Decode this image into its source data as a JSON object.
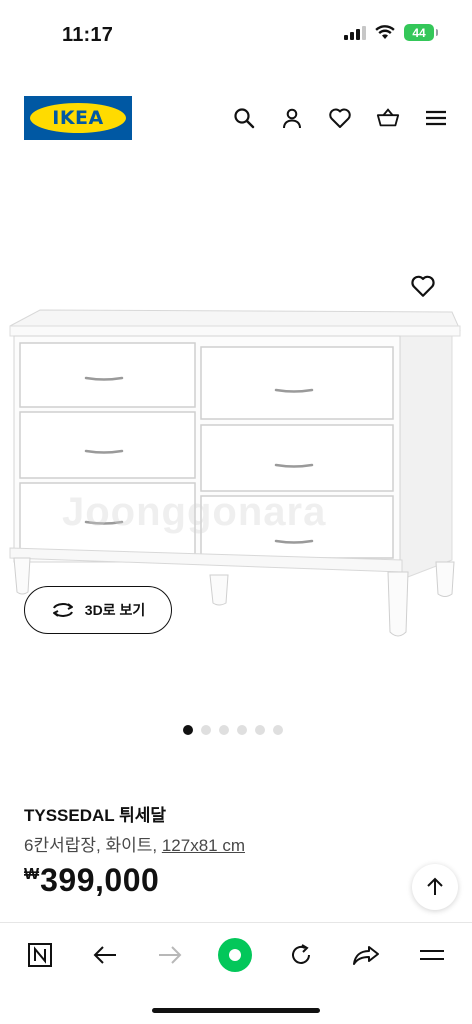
{
  "status_bar": {
    "time": "11:17",
    "battery": "44"
  },
  "header": {
    "logo_text": "IKEA",
    "icons": [
      "search-icon",
      "account-icon",
      "wishlist-heart-icon",
      "cart-basket-icon",
      "menu-icon"
    ]
  },
  "gallery": {
    "watermark": "Joonggonara",
    "view_3d_label": "3D로 보기",
    "total_images": 6,
    "active_index": 0
  },
  "product": {
    "name": "TYSSEDAL 튀세달",
    "description_prefix": "6칸서랍장, 화이트, ",
    "dimensions": "127x81 cm",
    "currency_symbol": "₩",
    "price": "399,000"
  },
  "browser_toolbar": {
    "buttons": [
      "naver-icon",
      "back-arrow-icon",
      "forward-arrow-icon",
      "green-dot-icon",
      "reload-icon",
      "share-icon",
      "menu-lines-icon"
    ]
  },
  "colors": {
    "ikea_blue": "#0058a3",
    "ikea_yellow": "#ffdb00",
    "battery_green": "#34c759",
    "accent_green": "#03c75a"
  }
}
